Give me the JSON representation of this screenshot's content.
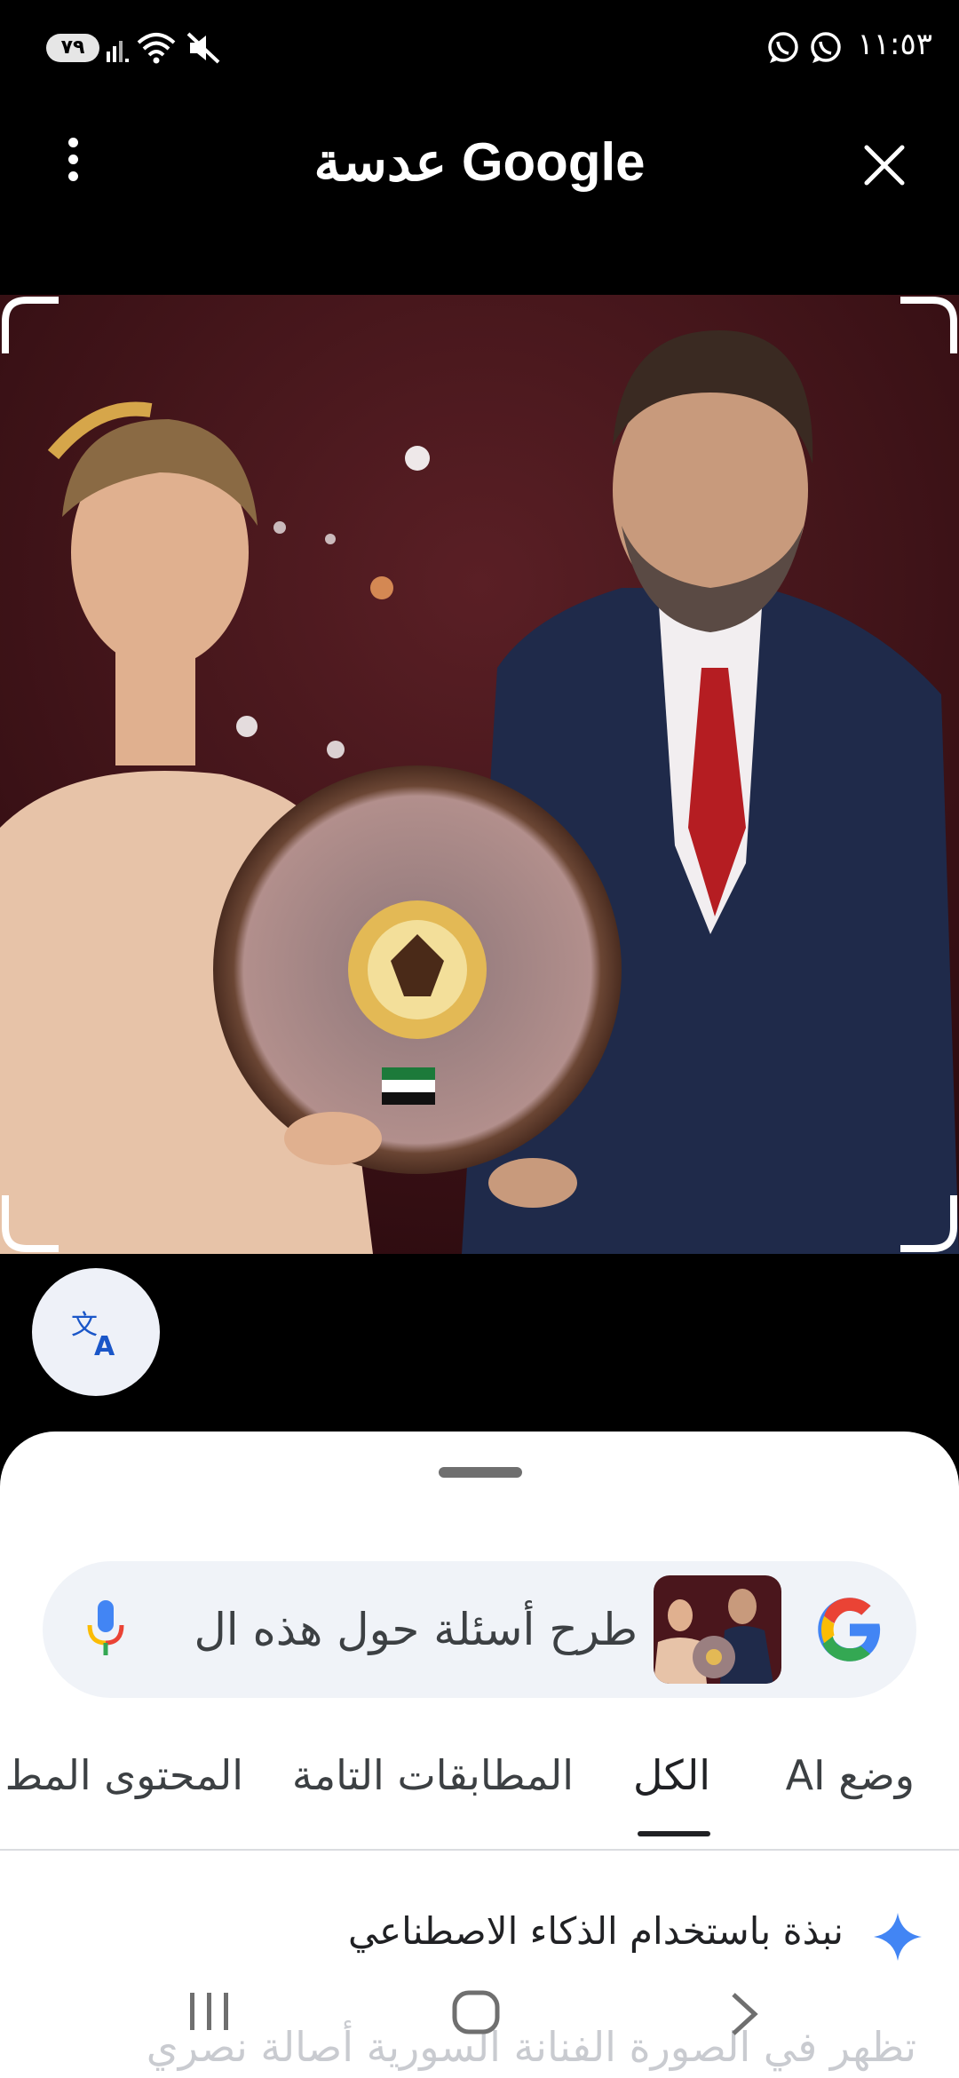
{
  "status_bar": {
    "battery": "٧٩",
    "time": "١١:٥٣"
  },
  "app_bar": {
    "title": "Google عدسة",
    "more_icon": "more-vert-icon",
    "close_icon": "close-icon"
  },
  "search": {
    "placeholder": "طرح أسئلة حول هذه ال",
    "mic_icon": "mic-icon",
    "logo": "google-g-logo"
  },
  "tabs": [
    {
      "label": "وضع AI"
    },
    {
      "label": "الكل",
      "selected": true
    },
    {
      "label": "المطابقات التامة"
    },
    {
      "label": "المحتوى المط"
    }
  ],
  "ai_overview": {
    "label": "نبذة باستخدام الذكاء الاصطناعي",
    "snippet": "تظهر في الصورة الفنانة السورية أصالة نصري"
  },
  "colors": {
    "accent_blue": "#4285F4",
    "sheet_bg": "#ffffff",
    "pill_bg": "#f0f3f8"
  }
}
